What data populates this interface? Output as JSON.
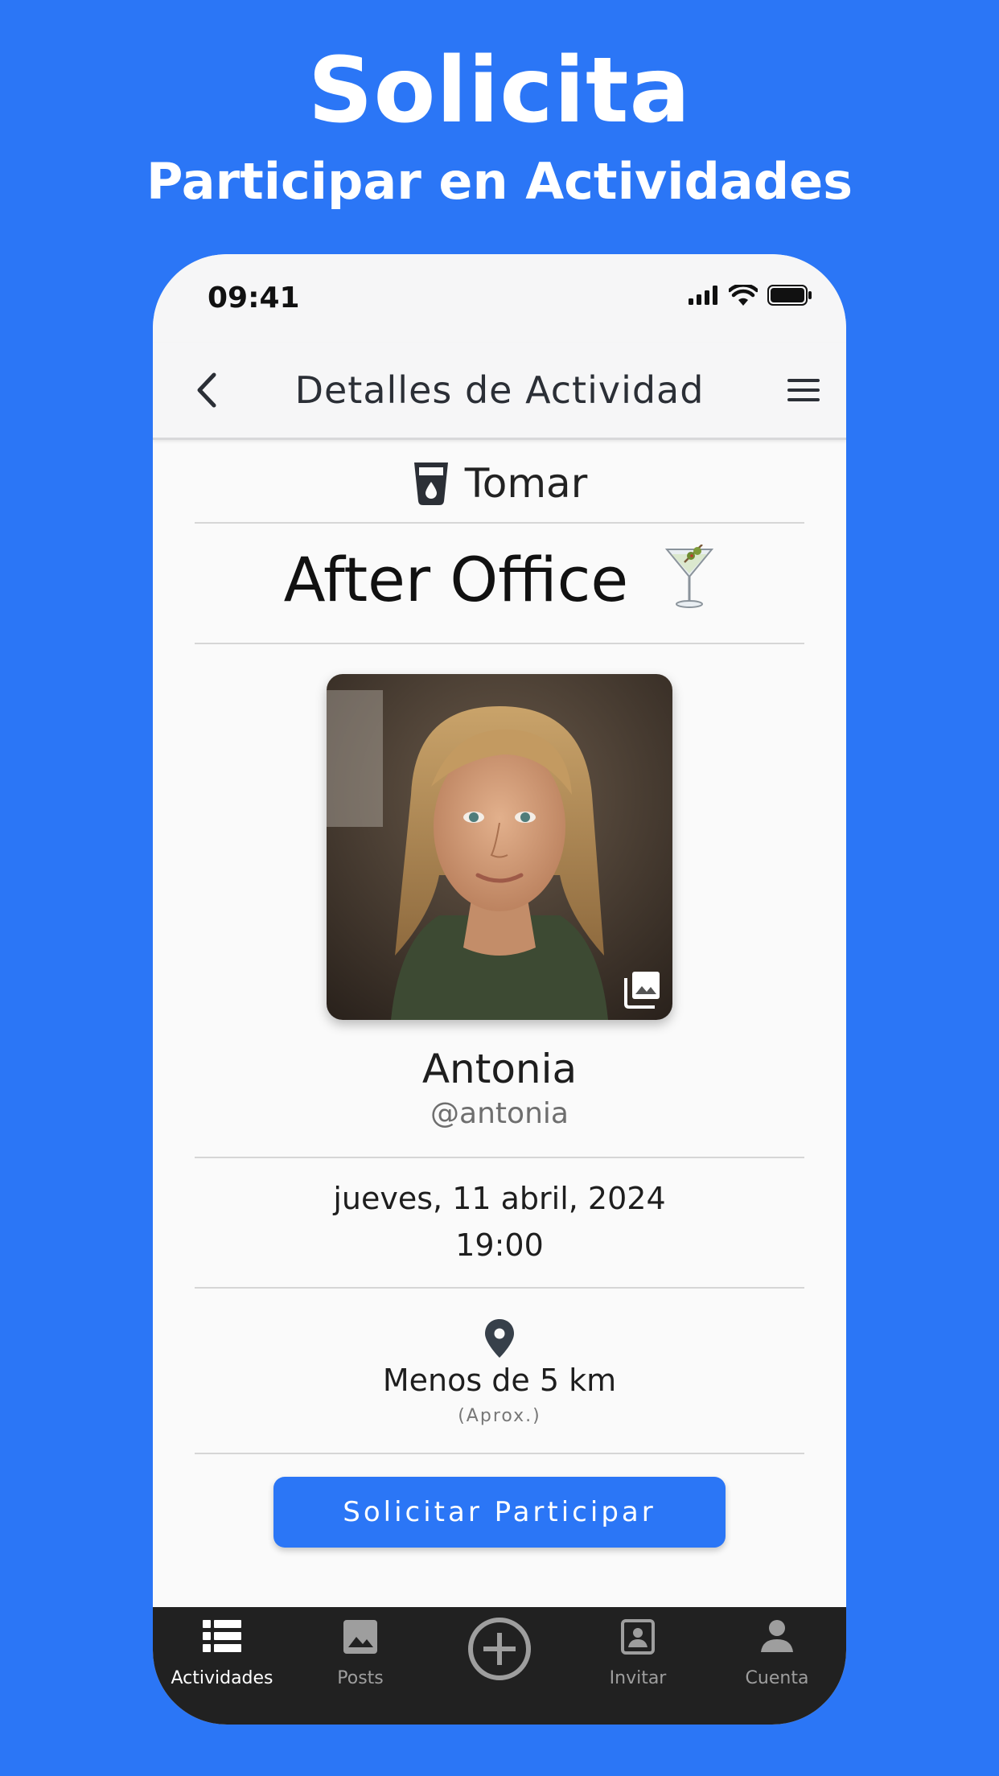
{
  "hero": {
    "title": "Solicita",
    "subtitle": "Participar en Actividades"
  },
  "status_bar": {
    "time": "09:41",
    "icons": [
      "signal-icon",
      "wifi-icon",
      "battery-icon"
    ]
  },
  "app_bar": {
    "title": "Detalles de Actividad",
    "left_icon": "back-chevron-icon",
    "right_icon": "hamburger-menu-icon"
  },
  "activity": {
    "category_icon": "drink-cup-icon",
    "category": "Tomar",
    "title": "After Office",
    "title_emoji": "cocktail-glass-icon"
  },
  "host": {
    "photo": "profile-photo",
    "photo_badge_icon": "photo-library-icon",
    "name": "Antonia",
    "handle": "@antonia"
  },
  "schedule": {
    "date": "jueves, 11 abril, 2024",
    "time": "19:00"
  },
  "location": {
    "icon": "location-pin-icon",
    "distance": "Menos de 5 km",
    "note": "(Aprox.)"
  },
  "cta": {
    "label": "Solicitar Participar"
  },
  "tab_bar": {
    "items": [
      {
        "label": "Actividades",
        "icon": "list-icon",
        "active": true
      },
      {
        "label": "Posts",
        "icon": "image-icon",
        "active": false
      },
      {
        "label": "",
        "icon": "add-circle-icon",
        "active": false
      },
      {
        "label": "Invitar",
        "icon": "contact-card-icon",
        "active": false
      },
      {
        "label": "Cuenta",
        "icon": "person-icon",
        "active": false
      }
    ]
  },
  "colors": {
    "background": "#2B76F6",
    "button": "#2B76F6",
    "tab_bar": "#212121",
    "screen": "#FAFAFA"
  }
}
